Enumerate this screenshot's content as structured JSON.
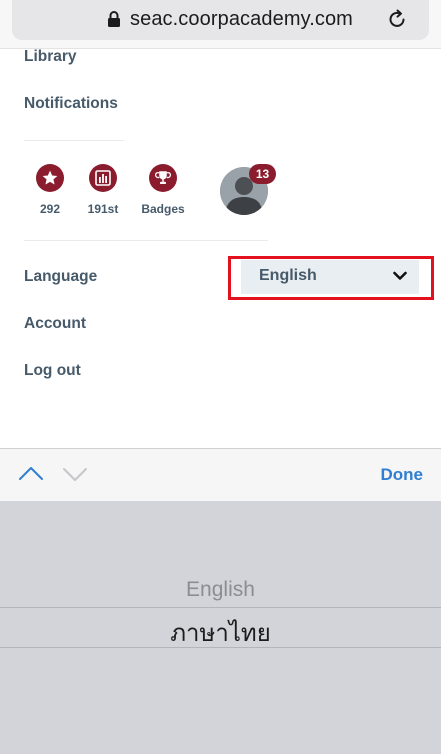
{
  "browser": {
    "url": "seac.coorpacademy.com"
  },
  "menu": {
    "library": "Library",
    "notifications": "Notifications",
    "language_label": "Language",
    "account": "Account",
    "logout": "Log out"
  },
  "stats": [
    {
      "icon": "star-icon",
      "value": "292"
    },
    {
      "icon": "ranking-chart-icon",
      "value": "191st"
    },
    {
      "icon": "trophy-icon",
      "value": "Badges"
    }
  ],
  "profile": {
    "notification_count": "13"
  },
  "language_select": {
    "selected": "English"
  },
  "picker_toolbar": {
    "done_label": "Done"
  },
  "picker": {
    "options": [
      "English",
      "ภาษาไทย"
    ],
    "selected_index": 1
  },
  "colors": {
    "accent": "#8a1c2e",
    "text": "#475a6a",
    "highlight": "#e3101e",
    "ios_blue": "#2f7ed1"
  }
}
